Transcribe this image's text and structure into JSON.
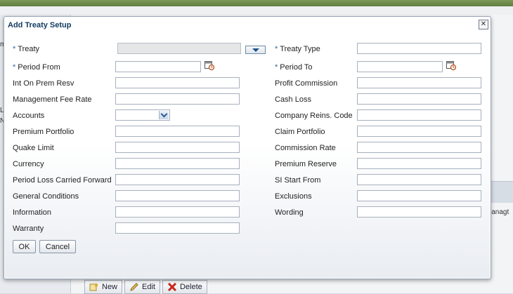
{
  "background": {
    "fragments": [
      "m",
      "L",
      "N",
      "lanagt"
    ],
    "toolbar": [
      {
        "label": "New",
        "icon": "new-icon"
      },
      {
        "label": "Edit",
        "icon": "edit-icon"
      },
      {
        "label": "Delete",
        "icon": "delete-icon"
      }
    ]
  },
  "dialog": {
    "title": "Add Treaty Setup",
    "required_marker": "*",
    "left": {
      "treaty": {
        "label": "Treaty",
        "value": ""
      },
      "period_from": {
        "label": "Period From",
        "value": ""
      },
      "int_on_prem_resv": {
        "label": "Int On Prem Resv",
        "value": ""
      },
      "management_fee_rate": {
        "label": "Management Fee Rate",
        "value": ""
      },
      "accounts": {
        "label": "Accounts",
        "value": ""
      },
      "premium_portfolio": {
        "label": "Premium Portfolio",
        "value": ""
      },
      "quake_limit": {
        "label": "Quake Limit",
        "value": ""
      },
      "currency": {
        "label": "Currency",
        "value": ""
      },
      "period_loss_carried_forward": {
        "label": "Period Loss Carried Forward",
        "value": ""
      },
      "general_conditions": {
        "label": "General Conditions",
        "value": ""
      },
      "information": {
        "label": "Information",
        "value": ""
      },
      "warranty": {
        "label": "Warranty",
        "value": ""
      }
    },
    "right": {
      "treaty_type": {
        "label": "Treaty Type",
        "value": ""
      },
      "period_to": {
        "label": "Period To",
        "value": ""
      },
      "profit_commission": {
        "label": "Profit Commission",
        "value": ""
      },
      "cash_loss": {
        "label": "Cash Loss",
        "value": ""
      },
      "company_reins_code": {
        "label": "Company Reins. Code",
        "value": ""
      },
      "claim_portfolio": {
        "label": "Claim Portfolio",
        "value": ""
      },
      "commission_rate": {
        "label": "Commission Rate",
        "value": ""
      },
      "premium_reserve": {
        "label": "Premium Reserve",
        "value": ""
      },
      "si_start_from": {
        "label": "SI Start From",
        "value": ""
      },
      "exclusions": {
        "label": "Exclusions",
        "value": ""
      },
      "wording": {
        "label": "Wording",
        "value": ""
      }
    },
    "buttons": {
      "ok": "OK",
      "cancel": "Cancel"
    }
  }
}
